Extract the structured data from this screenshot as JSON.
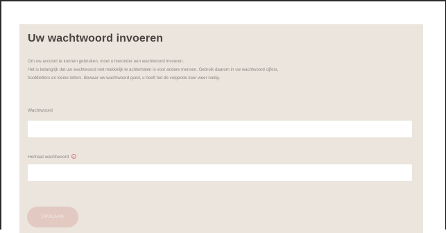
{
  "form": {
    "title": "Uw wachtwoord invoeren",
    "intro_line1": "Om uw account te kunnen gebruiken, moet u hieronder een wachtwoord invoeren.",
    "intro_line2": "Het is belangrijk dat uw wachtwoord niet makkelijk te achterhalen is voor andere mensen. Gebruik daarom in uw wachtwoord cijfers,",
    "intro_line3": "hoofdletters en kleine letters. Bewaar uw wachtwoord goed, u heeft het de volgende keer weer nodig.",
    "password_label": "Wachtwoord",
    "password_value": "",
    "repeat_label": "Herhaal wachtwoord",
    "repeat_value": "",
    "repeat_info_icon": "info-icon",
    "save_label": "OPSLAAN"
  },
  "colors": {
    "panel_bg": "#ebe5de",
    "title": "#4a4340",
    "muted_text": "#8e8580",
    "button_bg": "#e2c9c2",
    "info_icon": "#e07a7a"
  }
}
